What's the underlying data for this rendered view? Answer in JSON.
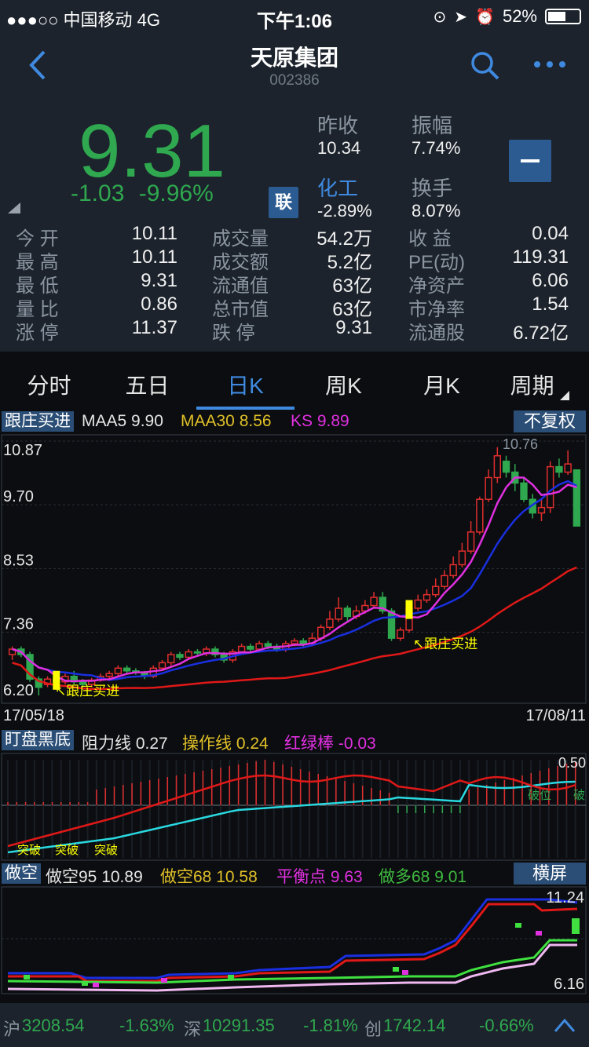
{
  "status": {
    "carrier": "●●●○○ 中国移动  4G",
    "time": "下午1:06",
    "battery": "52%",
    "battery_level": 0.52
  },
  "nav": {
    "title": "天原集团",
    "code": "002386",
    "back_icon": "chevron-left-icon",
    "search_icon": "search-icon",
    "more_icon": "more-icon"
  },
  "quote": {
    "price": "9.31",
    "change": "-1.03",
    "change_pct": "-9.96%",
    "lian": "联",
    "prev_close_label": "昨收",
    "prev_close": "10.34",
    "amplitude_label": "振幅",
    "amplitude": "7.74%",
    "sector_label": "化工",
    "sector_change": "-2.89%",
    "turnover_label": "换手",
    "turnover": "8.07%",
    "colors": {
      "down": "#2fa84f",
      "up": "#e02e2e",
      "accent": "#3f8ae0"
    }
  },
  "grid": [
    [
      {
        "l": "今  开",
        "v": "10.11"
      },
      {
        "l": "成交量",
        "v": "54.2万"
      },
      {
        "l": "收  益",
        "v": "0.04"
      }
    ],
    [
      {
        "l": "最  高",
        "v": "10.11"
      },
      {
        "l": "成交额",
        "v": "5.2亿"
      },
      {
        "l": "PE(动)",
        "v": "119.31"
      }
    ],
    [
      {
        "l": "最  低",
        "v": "9.31"
      },
      {
        "l": "流通值",
        "v": "63亿"
      },
      {
        "l": "净资产",
        "v": "6.06"
      }
    ],
    [
      {
        "l": "量  比",
        "v": "0.86"
      },
      {
        "l": "总市值",
        "v": "63亿"
      },
      {
        "l": "市净率",
        "v": "1.54"
      }
    ],
    [
      {
        "l": "涨  停",
        "v": "11.37"
      },
      {
        "l": "跌  停",
        "v": "9.31"
      },
      {
        "l": "流通股",
        "v": "6.72亿"
      }
    ]
  ],
  "tabs": [
    "分时",
    "五日",
    "日K",
    "周K",
    "月K",
    "周期"
  ],
  "active_tab": 2,
  "kline_bar": {
    "tag": "跟庄买进",
    "maa5": "MAA5 9.90",
    "maa30": "MAA30 8.56",
    "ks": "KS 9.89",
    "button": "不复权"
  },
  "indicator2_bar": {
    "tag": "盯盘黑底",
    "zl": "阻力线 0.27",
    "czx": "操作线 0.24",
    "hlb": "红绿棒 -0.03"
  },
  "indicator3_bar": {
    "tag": "做空",
    "zk95": "做空95 10.89",
    "zk68": "做空68 10.58",
    "phd": "平衡点 9.63",
    "zd68": "做多68 9.01",
    "button": "横屏"
  },
  "chart_data": [
    {
      "type": "candlestick",
      "ylim": [
        6.2,
        10.87
      ],
      "y_ticks": [
        "10.87",
        "9.70",
        "8.53",
        "7.36",
        "6.20"
      ],
      "x_start_label": "17/05/18",
      "x_end_label": "17/08/11",
      "max_label": "10.76",
      "annotation": "跟庄买进",
      "candles": [
        [
          6.95,
          7.05,
          6.85,
          7.1
        ],
        [
          7.05,
          6.95,
          6.9,
          7.1
        ],
        [
          6.95,
          6.5,
          6.45,
          7.0
        ],
        [
          6.5,
          6.35,
          6.2,
          6.55
        ],
        [
          6.4,
          6.5,
          6.35,
          6.55
        ],
        [
          6.5,
          6.45,
          6.4,
          6.55
        ],
        [
          6.45,
          6.55,
          6.4,
          6.6
        ],
        [
          6.55,
          6.45,
          6.4,
          6.65
        ],
        [
          6.45,
          6.4,
          6.3,
          6.5
        ],
        [
          6.4,
          6.48,
          6.35,
          6.52
        ],
        [
          6.48,
          6.55,
          6.45,
          6.6
        ],
        [
          6.55,
          6.6,
          6.5,
          6.65
        ],
        [
          6.6,
          6.7,
          6.55,
          6.75
        ],
        [
          6.7,
          6.65,
          6.6,
          6.75
        ],
        [
          6.65,
          6.62,
          6.58,
          6.7
        ],
        [
          6.62,
          6.55,
          6.5,
          6.65
        ],
        [
          6.55,
          6.7,
          6.52,
          6.75
        ],
        [
          6.7,
          6.8,
          6.65,
          6.85
        ],
        [
          6.8,
          6.95,
          6.75,
          7.0
        ],
        [
          6.95,
          6.9,
          6.85,
          7.0
        ],
        [
          6.9,
          7.0,
          6.85,
          7.05
        ],
        [
          7.0,
          6.98,
          6.92,
          7.05
        ],
        [
          6.98,
          7.05,
          6.92,
          7.1
        ],
        [
          7.05,
          6.95,
          6.9,
          7.1
        ],
        [
          6.95,
          6.85,
          6.8,
          7.0
        ],
        [
          6.85,
          7.0,
          6.8,
          7.05
        ],
        [
          7.0,
          7.1,
          6.95,
          7.15
        ],
        [
          7.1,
          7.05,
          7.0,
          7.15
        ],
        [
          7.05,
          7.15,
          7.0,
          7.2
        ],
        [
          7.15,
          7.1,
          7.05,
          7.2
        ],
        [
          7.1,
          7.05,
          7.0,
          7.15
        ],
        [
          7.05,
          7.15,
          7.0,
          7.2
        ],
        [
          7.15,
          7.2,
          7.1,
          7.25
        ],
        [
          7.2,
          7.15,
          7.1,
          7.25
        ],
        [
          7.15,
          7.25,
          7.1,
          7.35
        ],
        [
          7.25,
          7.45,
          7.2,
          7.5
        ],
        [
          7.45,
          7.6,
          7.4,
          7.75
        ],
        [
          7.6,
          7.8,
          7.55,
          8.0
        ],
        [
          7.8,
          7.65,
          7.55,
          7.85
        ],
        [
          7.65,
          7.75,
          7.6,
          7.85
        ],
        [
          7.75,
          7.85,
          7.7,
          7.95
        ],
        [
          7.85,
          8.0,
          7.8,
          8.1
        ],
        [
          8.0,
          7.75,
          7.7,
          8.1
        ],
        [
          7.75,
          7.25,
          7.2,
          7.8
        ],
        [
          7.25,
          7.4,
          7.2,
          7.45
        ],
        [
          7.4,
          7.8,
          7.35,
          7.85
        ],
        [
          7.8,
          7.95,
          7.75,
          8.05
        ],
        [
          7.95,
          8.05,
          7.9,
          8.15
        ],
        [
          8.05,
          8.2,
          8.0,
          8.35
        ],
        [
          8.2,
          8.4,
          8.15,
          8.5
        ],
        [
          8.4,
          8.6,
          8.35,
          8.75
        ],
        [
          8.6,
          8.85,
          8.55,
          9.0
        ],
        [
          8.85,
          9.2,
          8.8,
          9.4
        ],
        [
          9.2,
          9.8,
          9.15,
          9.85
        ],
        [
          9.8,
          10.2,
          9.75,
          10.35
        ],
        [
          10.2,
          10.6,
          10.1,
          10.76
        ],
        [
          10.5,
          10.3,
          10.2,
          10.6
        ],
        [
          10.3,
          10.1,
          9.95,
          10.45
        ],
        [
          10.1,
          9.8,
          9.75,
          10.2
        ],
        [
          9.8,
          9.55,
          9.45,
          9.9
        ],
        [
          9.55,
          9.65,
          9.4,
          9.8
        ],
        [
          9.65,
          10.4,
          9.55,
          10.5
        ],
        [
          10.4,
          10.3,
          10.2,
          10.55
        ],
        [
          10.3,
          10.45,
          10.25,
          10.7
        ],
        [
          10.34,
          9.31,
          9.31,
          10.11
        ]
      ]
    },
    {
      "type": "line",
      "ylim": [
        -0.1,
        0.5
      ],
      "y_ticks": [
        "0.50"
      ],
      "annotations": [
        "突破",
        "突破",
        "突破",
        "破位",
        "破"
      ]
    },
    {
      "type": "line",
      "ylim": [
        6.16,
        11.24
      ],
      "y_ticks": [
        "11.24",
        "6.16"
      ]
    }
  ],
  "bottom": [
    {
      "name": "沪",
      "value": "3208.54",
      "pct": "-1.63%"
    },
    {
      "name": "深",
      "value": "10291.35",
      "pct": "-1.81%"
    },
    {
      "name": "创",
      "value": "1742.14",
      "pct": "-0.66%"
    }
  ]
}
